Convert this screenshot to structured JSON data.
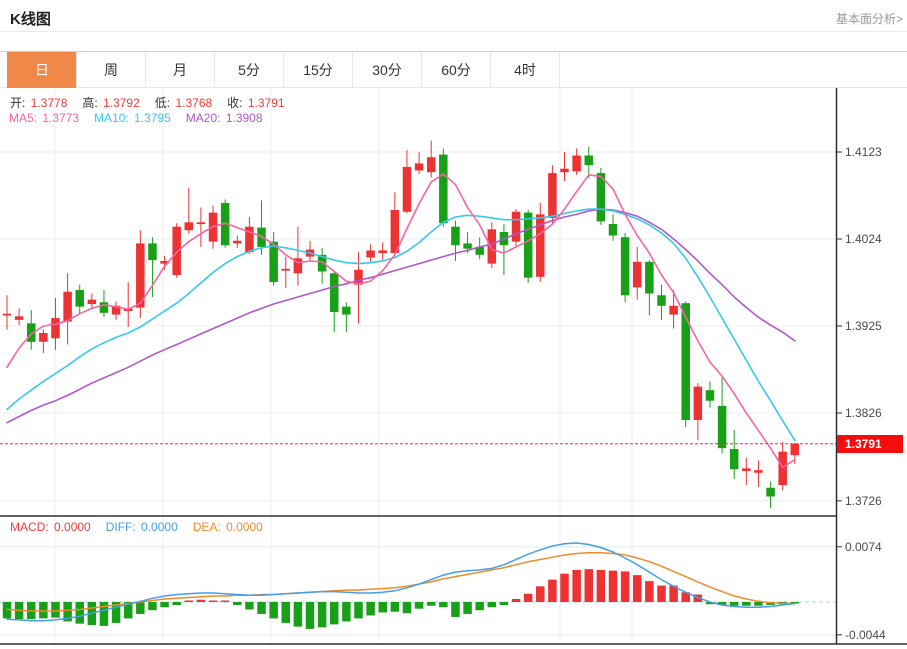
{
  "header": {
    "title": "K线图",
    "link": "基本面分析>"
  },
  "tabs": {
    "items": [
      "日",
      "周",
      "月",
      "5分",
      "15分",
      "30分",
      "60分",
      "4时"
    ],
    "names": [
      "tab-day",
      "tab-week",
      "tab-month",
      "tab-5min",
      "tab-15min",
      "tab-30min",
      "tab-60min",
      "tab-4hour"
    ],
    "active_index": 0
  },
  "colors": {
    "up": "#ec3232",
    "down": "#18a018",
    "ma5": "#f763a4",
    "ma10": "#36c8ee",
    "ma20": "#af58c8",
    "diff": "#459fe6",
    "dea": "#f18a2b",
    "accent": "#f0884a",
    "label": "#333333",
    "value_red": "#f23b3b",
    "axis_text": "#4a4a4a",
    "link": "#999999",
    "grid": "#e9eef6",
    "grid_macd": "#dfeaf3",
    "zero_line": "#a6d4ef",
    "price_line": "#ff2626",
    "price_tag_bg": "#f30d0d",
    "frame": "#2f2f2f"
  },
  "ohlc_row": [
    {
      "label": "开:",
      "value": "1.3778"
    },
    {
      "label": "高:",
      "value": "1.3792"
    },
    {
      "label": "低:",
      "value": "1.3768"
    },
    {
      "label": "收:",
      "value": "1.3791"
    }
  ],
  "ma_row": [
    {
      "label": "MA5:",
      "value": "1.3773",
      "color": "#f763a4"
    },
    {
      "label": "MA10:",
      "value": "1.3795",
      "color": "#36c8ee"
    },
    {
      "label": "MA20:",
      "value": "1.3908",
      "color": "#af58c8"
    }
  ],
  "macd_row": [
    {
      "label": "MACD:",
      "value": "0.0000",
      "color": "#f23b3b"
    },
    {
      "label": "DIFF:",
      "value": "0.0000",
      "color": "#459fe6"
    },
    {
      "label": "DEA:",
      "value": "0.0000",
      "color": "#f18a2b"
    }
  ],
  "chart_data": {
    "type": "candlestick",
    "title": "K线图",
    "legend_entries": [
      "MA5",
      "MA10",
      "MA20",
      "MACD",
      "DIFF",
      "DEA"
    ],
    "price_axis": {
      "ticks": [
        1.4123,
        1.4024,
        1.3925,
        1.3826,
        1.3726
      ],
      "range": [
        1.3715,
        1.414
      ],
      "position": "right"
    },
    "macd_axis": {
      "ticks": [
        0.0074,
        -0.0044
      ],
      "range": [
        -0.0046,
        0.008
      ],
      "position": "right"
    },
    "price_line": {
      "value": 1.3791,
      "label": "1.3791"
    },
    "last_values": {
      "open": 1.3778,
      "high": 1.3792,
      "low": 1.3768,
      "close": 1.3791,
      "ma5": 1.3773,
      "ma10": 1.3795,
      "ma20": 1.3908,
      "macd": 0.0,
      "diff": 0.0,
      "dea": 0.0
    },
    "candles": [
      [
        1.3937,
        1.396,
        1.3921,
        1.3939
      ],
      [
        1.3932,
        1.3945,
        1.3926,
        1.3936
      ],
      [
        1.3928,
        1.3943,
        1.3898,
        1.3907
      ],
      [
        1.3907,
        1.3921,
        1.3894,
        1.3917
      ],
      [
        1.3911,
        1.3957,
        1.3898,
        1.3934
      ],
      [
        1.393,
        1.3985,
        1.3904,
        1.3964
      ],
      [
        1.3966,
        1.3972,
        1.3938,
        1.3947
      ],
      [
        1.395,
        1.3962,
        1.3944,
        1.3955
      ],
      [
        1.3952,
        1.3966,
        1.3935,
        1.394
      ],
      [
        1.3938,
        1.3953,
        1.3932,
        1.3948
      ],
      [
        1.3942,
        1.3975,
        1.3924,
        1.3945
      ],
      [
        1.3946,
        1.4034,
        1.3934,
        1.4019
      ],
      [
        1.4019,
        1.4026,
        1.3958,
        1.4
      ],
      [
        1.3996,
        1.4005,
        1.3989,
        1.3999
      ],
      [
        1.3983,
        1.4042,
        1.398,
        1.4038
      ],
      [
        1.4034,
        1.4082,
        1.403,
        1.4043
      ],
      [
        1.4041,
        1.406,
        1.4015,
        1.4043
      ],
      [
        1.4021,
        1.4062,
        1.4013,
        1.4054
      ],
      [
        1.4065,
        1.4069,
        1.4014,
        1.4017
      ],
      [
        1.4019,
        1.4028,
        1.4014,
        1.4022
      ],
      [
        1.4009,
        1.4049,
        1.4007,
        1.4038
      ],
      [
        1.4037,
        1.4068,
        1.4006,
        1.4015
      ],
      [
        1.4021,
        1.4032,
        1.3971,
        1.3975
      ],
      [
        1.3988,
        1.4004,
        1.3968,
        1.399
      ],
      [
        1.3985,
        1.4038,
        1.3971,
        1.4002
      ],
      [
        1.4004,
        1.4022,
        1.3998,
        1.4012
      ],
      [
        1.4006,
        1.4014,
        1.3973,
        1.3987
      ],
      [
        1.3985,
        1.3988,
        1.3918,
        1.3941
      ],
      [
        1.3947,
        1.3952,
        1.3918,
        1.3938
      ],
      [
        1.3972,
        1.4009,
        1.3928,
        1.3989
      ],
      [
        1.4003,
        1.4018,
        1.3996,
        1.4011
      ],
      [
        1.4008,
        1.402,
        1.4,
        1.4011
      ],
      [
        1.4008,
        1.4077,
        1.4006,
        1.4057
      ],
      [
        1.4055,
        1.4125,
        1.4053,
        1.4106
      ],
      [
        1.4102,
        1.4123,
        1.4098,
        1.411
      ],
      [
        1.41,
        1.4136,
        1.4094,
        1.4117
      ],
      [
        1.412,
        1.4127,
        1.4038,
        1.4042
      ],
      [
        1.4038,
        1.4045,
        1.3999,
        1.4017
      ],
      [
        1.4019,
        1.4032,
        1.4008,
        1.4013
      ],
      [
        1.4015,
        1.4026,
        1.4001,
        1.4006
      ],
      [
        1.3996,
        1.4043,
        1.3991,
        1.4035
      ],
      [
        1.4032,
        1.4041,
        1.3983,
        1.4017
      ],
      [
        1.4021,
        1.4058,
        1.4015,
        1.4055
      ],
      [
        1.4054,
        1.4057,
        1.3974,
        1.398
      ],
      [
        1.3981,
        1.4065,
        1.3975,
        1.4052
      ],
      [
        1.4048,
        1.4108,
        1.4042,
        1.4099
      ],
      [
        1.41,
        1.4123,
        1.409,
        1.4104
      ],
      [
        1.4101,
        1.4127,
        1.4097,
        1.4119
      ],
      [
        1.4119,
        1.4129,
        1.4093,
        1.4108
      ],
      [
        1.4099,
        1.4105,
        1.404,
        1.4044
      ],
      [
        1.4041,
        1.4052,
        1.4022,
        1.4028
      ],
      [
        1.4026,
        1.4031,
        1.3952,
        1.396
      ],
      [
        1.3969,
        1.4015,
        1.3955,
        1.3998
      ],
      [
        1.3998,
        1.4,
        1.3937,
        1.3962
      ],
      [
        1.396,
        1.3972,
        1.3932,
        1.3948
      ],
      [
        1.3938,
        1.3966,
        1.3922,
        1.3948
      ],
      [
        1.3951,
        1.3953,
        1.381,
        1.3818
      ],
      [
        1.3818,
        1.386,
        1.3795,
        1.3856
      ],
      [
        1.3852,
        1.3862,
        1.3832,
        1.384
      ],
      [
        1.3834,
        1.3868,
        1.378,
        1.3786
      ],
      [
        1.3785,
        1.3807,
        1.3751,
        1.3762
      ],
      [
        1.376,
        1.3775,
        1.3744,
        1.3763
      ],
      [
        1.3758,
        1.3772,
        1.3742,
        1.3761
      ],
      [
        1.3741,
        1.3748,
        1.3718,
        1.3731
      ],
      [
        1.3744,
        1.3793,
        1.3738,
        1.3782
      ],
      [
        1.3778,
        1.3792,
        1.3768,
        1.3791
      ]
    ],
    "ma5": [
      1.3878,
      1.39,
      1.3916,
      1.3925,
      1.3927,
      1.3931,
      1.3939,
      1.3945,
      1.3949,
      1.3947,
      1.3944,
      1.3951,
      1.3971,
      1.3993,
      1.4009,
      1.4021,
      1.403,
      1.4038,
      1.4042,
      1.4037,
      1.4032,
      1.4027,
      1.4018,
      1.4006,
      1.3997,
      1.3999,
      1.3998,
      1.3987,
      1.3976,
      1.3973,
      1.3976,
      1.3988,
      1.4006,
      1.4036,
      1.4064,
      1.4089,
      1.4098,
      1.4086,
      1.406,
      1.404,
      1.4012,
      1.4008,
      1.4015,
      1.4022,
      1.403,
      1.4041,
      1.4058,
      1.4078,
      1.4097,
      1.4095,
      1.4081,
      1.4052,
      1.4028,
      1.4008,
      1.3983,
      1.3963,
      1.3935,
      1.3908,
      1.3884,
      1.3868,
      1.3848,
      1.3826,
      1.3806,
      1.3786,
      1.3764,
      1.3773
    ],
    "ma10": [
      1.383,
      1.3842,
      1.3852,
      1.3862,
      1.3871,
      1.388,
      1.389,
      1.3899,
      1.3906,
      1.3912,
      1.3917,
      1.3924,
      1.3933,
      1.3942,
      1.3951,
      1.3962,
      1.3974,
      1.3986,
      1.3996,
      1.4004,
      1.401,
      1.4014,
      1.4016,
      1.4014,
      1.4011,
      1.4008,
      1.4004,
      1.4,
      1.3997,
      1.3996,
      1.3997,
      1.3999,
      1.4003,
      1.401,
      1.402,
      1.4032,
      1.4043,
      1.4049,
      1.4051,
      1.405,
      1.4048,
      1.4046,
      1.4046,
      1.4047,
      1.4048,
      1.405,
      1.4053,
      1.4056,
      1.4058,
      1.4058,
      1.4056,
      1.4052,
      1.4047,
      1.404,
      1.4031,
      1.4019,
      1.4002,
      1.3981,
      1.3958,
      1.3934,
      1.391,
      1.3886,
      1.3862,
      1.384,
      1.3817,
      1.3795
    ],
    "ma20": [
      1.3815,
      1.3822,
      1.3829,
      1.3835,
      1.384,
      1.3846,
      1.3853,
      1.386,
      1.3866,
      1.3872,
      1.3878,
      1.3885,
      1.3892,
      1.3898,
      1.3904,
      1.391,
      1.3916,
      1.3922,
      1.3928,
      1.3934,
      1.394,
      1.3945,
      1.395,
      1.3954,
      1.3958,
      1.3962,
      1.3966,
      1.397,
      1.3973,
      1.3977,
      1.398,
      1.3984,
      1.3988,
      1.3992,
      1.3996,
      1.4,
      1.4004,
      1.4008,
      1.4011,
      1.4015,
      1.4018,
      1.4024,
      1.403,
      1.4035,
      1.404,
      1.4045,
      1.4049,
      1.4052,
      1.4056,
      1.4058,
      1.4057,
      1.4054,
      1.405,
      1.4043,
      1.4035,
      1.4024,
      1.4012,
      1.3999,
      1.3985,
      1.3972,
      1.3958,
      1.3946,
      1.3935,
      1.3926,
      1.3918,
      1.3908
    ],
    "macd": {
      "hist": [
        -0.0022,
        -0.0023,
        -0.0023,
        -0.0022,
        -0.0021,
        -0.0026,
        -0.0029,
        -0.0031,
        -0.0032,
        -0.0028,
        -0.0022,
        -0.0016,
        -0.0011,
        -0.0007,
        -0.0004,
        0.0002,
        0.0003,
        0.0002,
        0.0002,
        -0.0004,
        -0.001,
        -0.0016,
        -0.0022,
        -0.0028,
        -0.0033,
        -0.0036,
        -0.0034,
        -0.003,
        -0.0026,
        -0.0022,
        -0.0018,
        -0.0014,
        -0.0013,
        -0.0015,
        -0.0009,
        -0.0005,
        -0.0007,
        -0.002,
        -0.0016,
        -0.0011,
        -0.0007,
        -0.0004,
        0.0004,
        0.0011,
        0.0021,
        0.003,
        0.0038,
        0.0043,
        0.0044,
        0.0043,
        0.0042,
        0.0041,
        0.0036,
        0.0028,
        0.0022,
        0.0022,
        0.0013,
        0.001,
        -0.0003,
        -0.0004,
        -0.0005,
        -0.0005,
        -0.0005,
        -0.0004,
        -0.0003,
        -0.0002
      ],
      "diff": [
        -0.0023,
        -0.0024,
        -0.0025,
        -0.0025,
        -0.0024,
        -0.0022,
        -0.0019,
        -0.0015,
        -0.0011,
        -0.0007,
        -0.0003,
        0.0001,
        0.0005,
        0.0008,
        0.001,
        0.0011,
        0.0012,
        0.0012,
        0.0011,
        0.001,
        0.0009,
        0.0009,
        0.001,
        0.0011,
        0.0012,
        0.0013,
        0.0014,
        0.0014,
        0.0013,
        0.0012,
        0.0012,
        0.0013,
        0.0015,
        0.0019,
        0.0024,
        0.003,
        0.0036,
        0.004,
        0.0042,
        0.0043,
        0.0045,
        0.005,
        0.0057,
        0.0064,
        0.007,
        0.0075,
        0.0078,
        0.0079,
        0.0077,
        0.0073,
        0.0067,
        0.0059,
        0.005,
        0.004,
        0.003,
        0.0021,
        0.0013,
        0.0006,
        0.0,
        -0.0004,
        -0.0006,
        -0.0007,
        -0.0007,
        -0.0006,
        -0.0004,
        -0.0002
      ],
      "dea": [
        -0.001,
        -0.0011,
        -0.0012,
        -0.0012,
        -0.0012,
        -0.0011,
        -0.001,
        -0.0008,
        -0.0006,
        -0.0004,
        -0.0002,
        0.0,
        0.0002,
        0.0004,
        0.0005,
        0.0006,
        0.0007,
        0.0008,
        0.0008,
        0.0009,
        0.0009,
        0.001,
        0.001,
        0.0011,
        0.0012,
        0.0013,
        0.0014,
        0.0015,
        0.0016,
        0.0016,
        0.0017,
        0.0018,
        0.0019,
        0.0021,
        0.0024,
        0.0027,
        0.0031,
        0.0034,
        0.0037,
        0.004,
        0.0043,
        0.0046,
        0.005,
        0.0054,
        0.0057,
        0.006,
        0.0063,
        0.0065,
        0.0066,
        0.0066,
        0.0065,
        0.0063,
        0.0059,
        0.0054,
        0.0048,
        0.0041,
        0.0034,
        0.0027,
        0.002,
        0.0014,
        0.0008,
        0.0004,
        0.0001,
        -0.0001,
        -0.0002,
        -0.0002
      ]
    }
  }
}
